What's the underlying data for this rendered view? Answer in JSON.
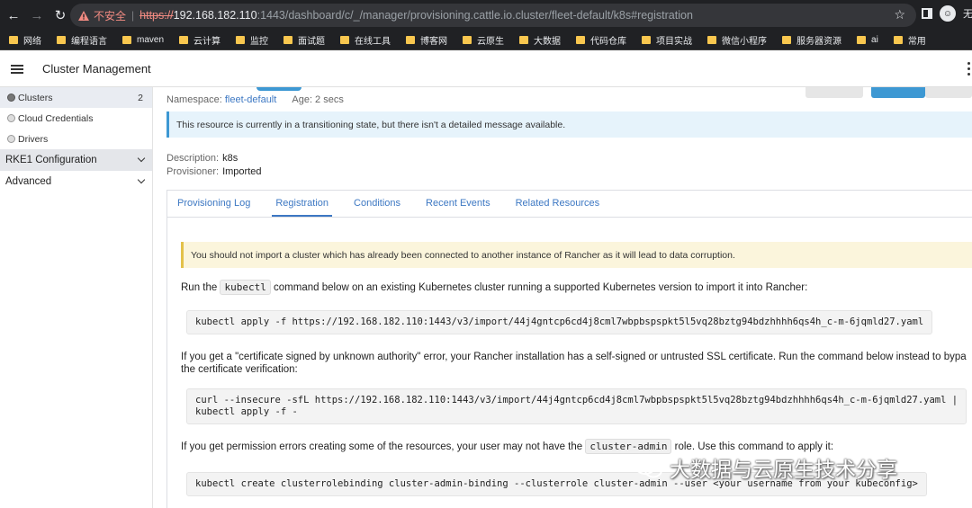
{
  "browser": {
    "insecure_label": "不安全",
    "url_scheme": "https://",
    "url_host": "192.168.182.110",
    "url_path": ":1443/dashboard/c/_/manager/provisioning.cattle.io.cluster/fleet-default/k8s#registration",
    "profile_text": "无"
  },
  "bookmarks": [
    "网络",
    "编程语言",
    "maven",
    "云计算",
    "监控",
    "面试题",
    "在线工具",
    "博客网",
    "云原生",
    "大数据",
    "代码仓库",
    "项目实战",
    "微信小程序",
    "服务器资源",
    "ai",
    "常用"
  ],
  "header": {
    "title": "Cluster Management"
  },
  "sidebar": {
    "items": [
      {
        "label": "Clusters",
        "count": "2"
      },
      {
        "label": "Cloud Credentials"
      },
      {
        "label": "Drivers"
      }
    ],
    "groups": [
      {
        "label": "RKE1 Configuration"
      },
      {
        "label": "Advanced"
      }
    ]
  },
  "resource": {
    "namespace_label": "Namespace:",
    "namespace_value": "fleet-default",
    "age": "Age: 2 secs",
    "transition_message": "This resource is currently in a transitioning state, but there isn't a detailed message available.",
    "description_label": "Description:",
    "description_value": "k8s",
    "provisioner_label": "Provisioner:",
    "provisioner_value": "Imported"
  },
  "tabs": [
    "Provisioning Log",
    "Registration",
    "Conditions",
    "Recent Events",
    "Related Resources"
  ],
  "registration": {
    "warning": "You should not import a cluster which has already been connected to another instance of Rancher as it will lead to data corruption.",
    "p1_before": "Run the ",
    "p1_code": "kubectl",
    "p1_after": " command below on an existing Kubernetes cluster running a supported Kubernetes version to import it into Rancher:",
    "cmd1": "kubectl apply -f https://192.168.182.110:1443/v3/import/44j4gntcp6cd4j8cml7wbpbspspkt5l5vq28bztg94bdzhhhh6qs4h_c-m-6jqmld27.yaml",
    "p2_line1": "If you get a \"certificate signed by unknown authority\" error, your Rancher installation has a self-signed or untrusted SSL certificate. Run the command below instead to bypa",
    "p2_line2": "the certificate verification:",
    "cmd2_line1": "curl --insecure -sfL https://192.168.182.110:1443/v3/import/44j4gntcp6cd4j8cml7wbpbspspkt5l5vq28bztg94bdzhhhh6qs4h_c-m-6jqmld27.yaml |",
    "cmd2_line2": "kubectl apply -f -",
    "p3_before": "If you get permission errors creating some of the resources, your user may not have the ",
    "p3_code": "cluster-admin",
    "p3_after": " role. Use this command to apply it:",
    "cmd3": "kubectl create clusterrolebinding cluster-admin-binding --clusterrole cluster-admin --user <your username from your kubeconfig>"
  },
  "watermark": "大数据与云原生技术分享",
  "colors": {
    "link": "#3d78c3",
    "info_border": "#3d98d3",
    "warn_border": "#e3c14a"
  }
}
